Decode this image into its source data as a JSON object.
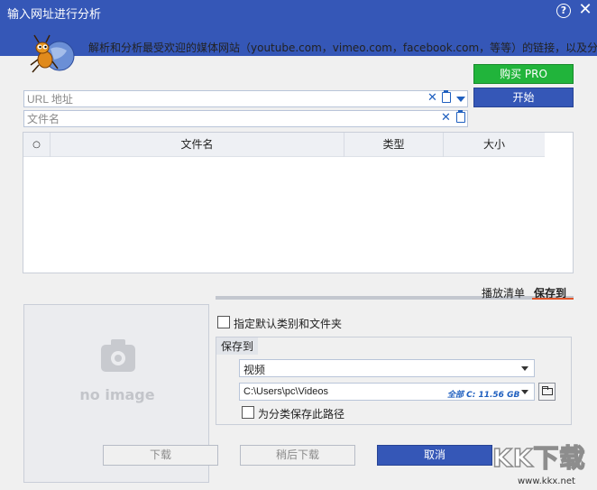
{
  "window": {
    "title": "输入网址进行分析",
    "help_label": "?",
    "close_label": "✕"
  },
  "banner": {
    "text": "解析和分析最受欢迎的媒体网站（youtube.com，vimeo.com，facebook.com，等等）的链接，以及分..."
  },
  "buttons": {
    "buy_pro": "购买 PRO",
    "start": "开始",
    "download": "下载",
    "download_later": "稍后下载",
    "cancel": "取消"
  },
  "url_field": {
    "placeholder": "URL 地址",
    "value": ""
  },
  "filename_field": {
    "placeholder": "文件名",
    "value": ""
  },
  "table": {
    "columns": [
      "○",
      "文件名",
      "类型",
      "大小"
    ],
    "rows": []
  },
  "tabs": {
    "playlist": "播放清单",
    "save_to": "保存到",
    "active": "save_to"
  },
  "preview": {
    "text": "no image"
  },
  "default_category_checkbox": {
    "label": "指定默认类别和文件夹",
    "checked": false
  },
  "save_group": {
    "title": "保存到",
    "category": "视频",
    "path": "C:\\Users\\pc\\Videos",
    "disk_info": "全部 C: 11.56 GB",
    "remember_checkbox": {
      "label": "为分类保存此路径",
      "checked": false
    }
  },
  "watermark": {
    "text": "KK下载",
    "url": "www.kkx.net"
  },
  "colors": {
    "title_bar": "#3557b7",
    "buy_button": "#21b43b",
    "start_button": "#3557b7",
    "cancel_button": "#3557b7",
    "tab_underline": "#e0552a",
    "icon_accent": "#1f5fbf"
  },
  "icons": [
    "help-icon",
    "close-icon",
    "ant-logo-icon",
    "clear-icon",
    "paste-icon",
    "dropdown-icon",
    "camera-icon",
    "folder-icon"
  ]
}
